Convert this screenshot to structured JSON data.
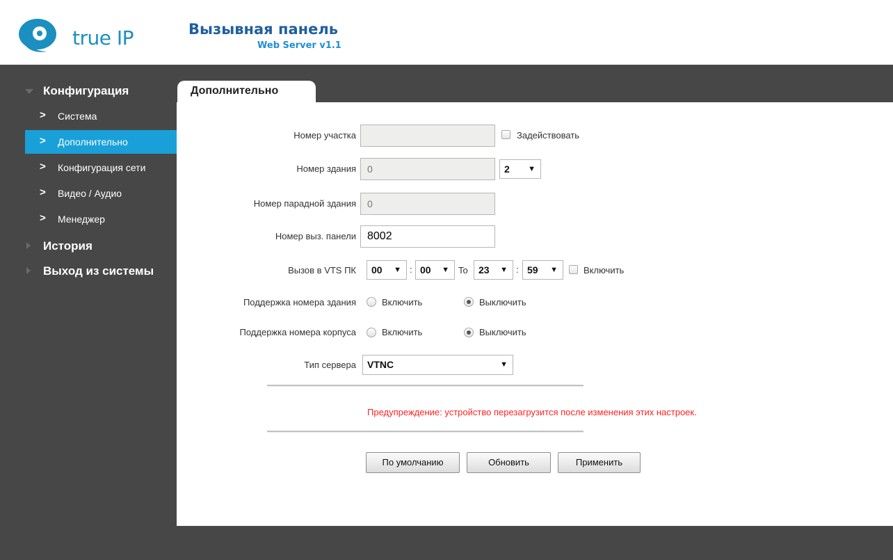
{
  "header": {
    "brand": "true IP",
    "title": "Вызывная панель",
    "subtitle": "Web Server v1.1"
  },
  "sidebar": {
    "config_label": "Конфигурация",
    "items": [
      {
        "label": "Система"
      },
      {
        "label": "Дополнительно"
      },
      {
        "label": "Конфигурация сети"
      },
      {
        "label": "Видео / Аудио"
      },
      {
        "label": "Менеджер"
      }
    ],
    "history_label": "История",
    "logout_label": "Выход из системы"
  },
  "tab": {
    "label": "Дополнительно"
  },
  "form": {
    "plot": {
      "label": "Номер участка",
      "value": "",
      "check_label": "Задействовать"
    },
    "building": {
      "label": "Номер здания",
      "value": "0",
      "select": "2"
    },
    "entrance": {
      "label": "Номер парадной здания",
      "value": "0"
    },
    "panel": {
      "label": "Номер выз. панели",
      "value": "8002"
    },
    "vts": {
      "label": "Вызов в VTS ПК",
      "from_h": "00",
      "from_m": "00",
      "to": "To",
      "to_h": "23",
      "to_m": "59",
      "colon": ":",
      "check_label": "Включить"
    },
    "bld_support": {
      "label": "Поддержка номера здания",
      "on": "Включить",
      "off": "Выключить"
    },
    "corp_support": {
      "label": "Поддержка номера корпуса",
      "on": "Включить",
      "off": "Выключить"
    },
    "server": {
      "label": "Тип сервера",
      "value": "VTNC"
    }
  },
  "warning": "Предупреждение: устройство перезагрузится после изменения этих настроек.",
  "buttons": {
    "default": "По умолчанию",
    "refresh": "Обновить",
    "apply": "Применить"
  },
  "colors": {
    "accent": "#1aa0d8",
    "dark": "#474747",
    "warning": "#ff2222"
  }
}
